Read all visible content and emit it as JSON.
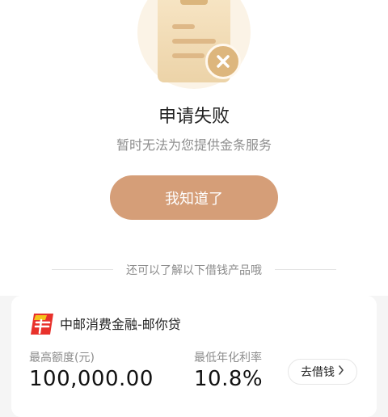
{
  "status": {
    "title": "申请失败",
    "message": "暂时无法为您提供金条服务",
    "confirm_label": "我知道了"
  },
  "recommend": {
    "divider_text": "还可以了解以下借钱产品哦"
  },
  "product": {
    "name": "中邮消费金融-邮你贷",
    "limit_label": "最高额度(元)",
    "limit_value": "100,000.00",
    "rate_label": "最低年化利率",
    "rate_value": "10.8%",
    "borrow_label": "去借钱"
  },
  "colors": {
    "accent": "#d59e78",
    "illustration": "#ddb67d",
    "logo_red": "#e8312b",
    "logo_yellow": "#f4c21a"
  }
}
